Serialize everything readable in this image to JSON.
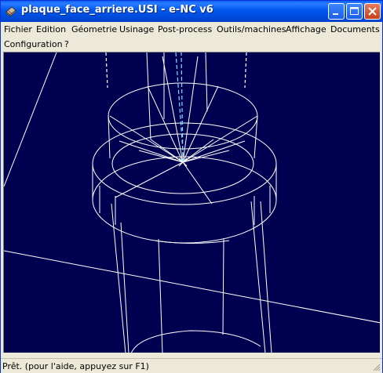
{
  "window": {
    "title": "plaque_face_arriere.USI - e-NC v6"
  },
  "menu": [
    "Fichier",
    "Edition",
    "Géometrie",
    "Usinage",
    "Post-process",
    "Outils/machines",
    "Affichage",
    "Documents",
    "Configuration",
    "?"
  ],
  "statusbar": {
    "text": "Prêt. (pour l'aide, appuyez sur F1)"
  },
  "icons": {
    "app": "app-icon",
    "minimize": "minimize-icon",
    "maximize": "maximize-icon",
    "close": "close-icon",
    "grip": "resize-grip-icon"
  },
  "colors": {
    "title_bar": "#0058ee",
    "viewport_bg": "#000050",
    "wireframe": "#ffffff",
    "tool_path": "#7fe0ff"
  }
}
